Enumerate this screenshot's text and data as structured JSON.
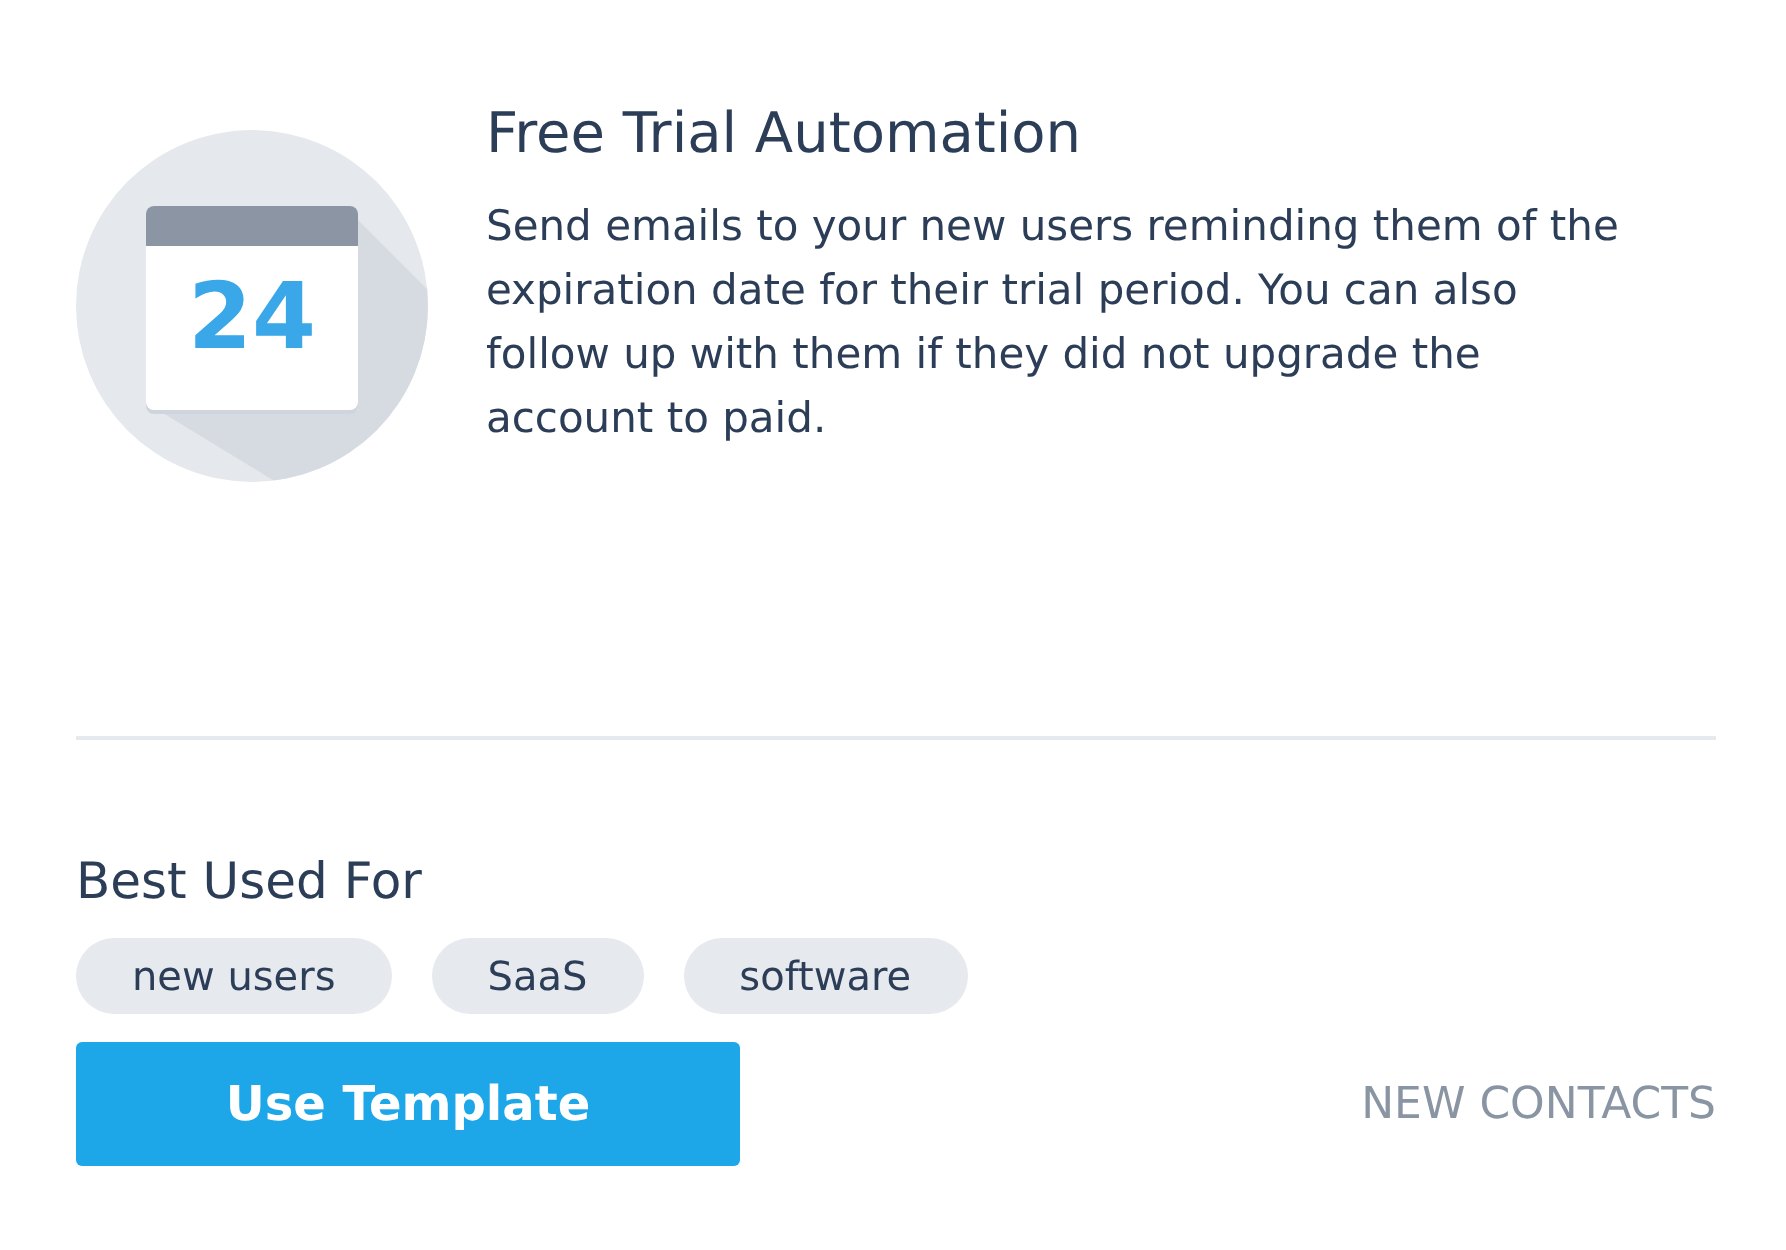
{
  "title": "Free Trial Automation",
  "description": "Send emails to your new users reminding them of the expiration date for their trial period. You can also follow up with them if they did not upgrade the account to paid.",
  "calendar": {
    "day": "24"
  },
  "best_used_for": {
    "heading": "Best Used For",
    "tags": [
      "new users",
      "SaaS",
      "software"
    ]
  },
  "button": "Use Template",
  "category": "NEW CONTACTS"
}
